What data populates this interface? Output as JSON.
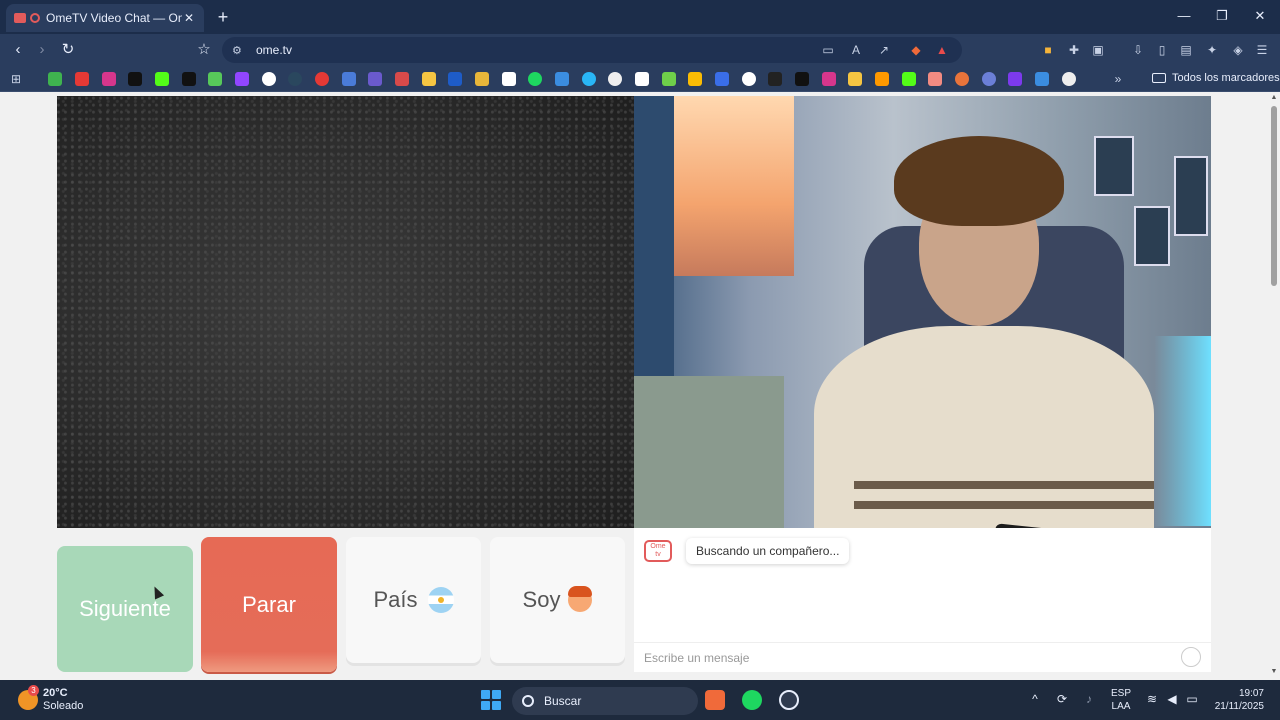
{
  "browser": {
    "tab": {
      "title": "OmeTV Video Chat — Omegl",
      "close": "✕"
    },
    "new_tab": "+",
    "window_controls": {
      "minimize": "—",
      "maximize": "❐",
      "close": "✕"
    },
    "url": "ome.tv",
    "bookmarks_all": "Todos los marcadores",
    "bookmark_overflow": "»"
  },
  "chat_buttons": {
    "next": "Siguiente",
    "stop": "Parar",
    "country": "País",
    "me": "Soy"
  },
  "chat": {
    "status": "Buscando un compañero...",
    "input_placeholder": "Escribe un mensaje",
    "logo_line1": "Ome",
    "logo_line2": "tv"
  },
  "taskbar": {
    "weather_temp": "20°C",
    "weather_desc": "Soleado",
    "weather_badge": "3",
    "search_label": "Buscar",
    "lang_line1": "ESP",
    "lang_line2": "LAA",
    "time": "19:07",
    "date": "21/11/2025"
  },
  "colors": {
    "next_button": "#a8d8b8",
    "stop_button": "#e66a55",
    "brand_red": "#e25b5b"
  }
}
